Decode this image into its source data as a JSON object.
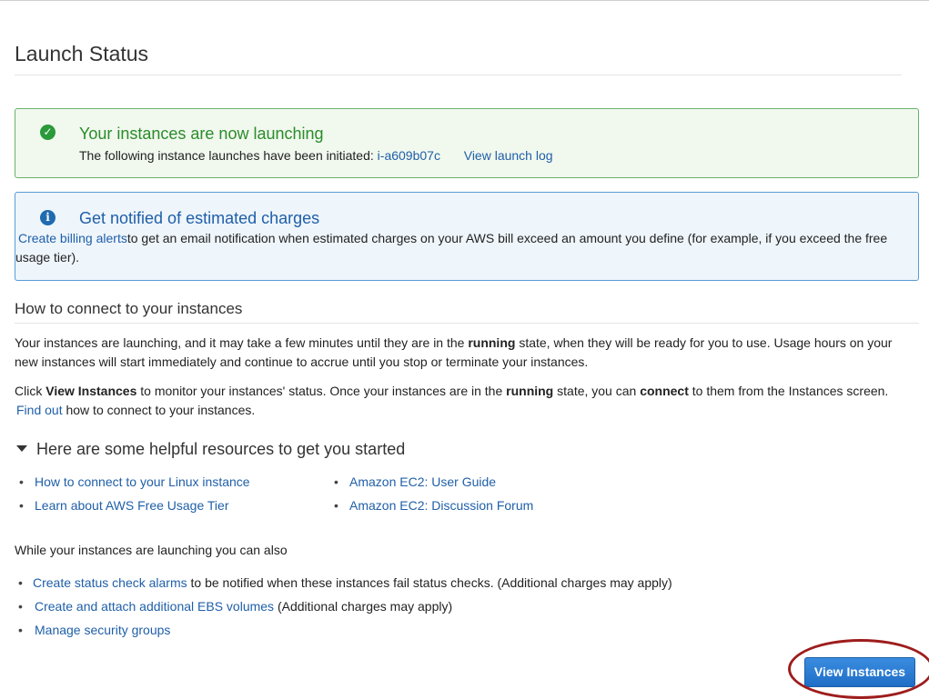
{
  "page": {
    "title": "Launch Status"
  },
  "success_alert": {
    "title": "Your instances are now launching",
    "body_text": "The following instance launches have been initiated:",
    "instance_id": "i-a609b07c",
    "log_link": "View launch log"
  },
  "info_alert": {
    "title": "Get notified of estimated charges",
    "link": "Create billing alerts",
    "body_text": "to get an email notification when estimated charges on your AWS bill exceed an amount you define (for example, if you exceed the free usage tier)."
  },
  "connect": {
    "heading": "How to connect to your instances",
    "p1_a": "Your instances are launching, and it may take a few minutes until they are in the ",
    "p1_bold": "running",
    "p1_b": " state, when they will be ready for you to use. Usage hours on your new instances will start immediately and continue to accrue until you stop or terminate your instances.",
    "p2_a": "Click ",
    "p2_bold1": "View Instances",
    "p2_b": " to monitor your instances' status. Once your instances are in the ",
    "p2_bold2": "running",
    "p2_c": " state, you can ",
    "p2_bold3": "connect",
    "p2_d": " to them from the Instances screen.",
    "find_out_link": "Find out",
    "p2_e": "how to connect to your instances."
  },
  "resources": {
    "heading": "Here are some helpful resources to get you started",
    "left": [
      "How to connect to your Linux instance",
      "Learn about AWS Free Usage Tier"
    ],
    "right": [
      "Amazon EC2: User Guide",
      "Amazon EC2: Discussion Forum"
    ]
  },
  "also": {
    "intro": "While your instances are launching you can also",
    "items": [
      {
        "link": "Create status check alarms",
        "text": "to be notified when these instances fail status checks. (Additional charges may apply)"
      },
      {
        "link": "Create and attach additional EBS volumes",
        "text": "(Additional charges may apply)"
      },
      {
        "link": "Manage security groups",
        "text": ""
      }
    ]
  },
  "button": {
    "label": "View Instances"
  },
  "colors": {
    "success": "#2a8c2a",
    "info": "#1f5fa8",
    "link": "#1f5fa8",
    "button": "#1f6ec6",
    "highlight_ring": "#9e1d1d"
  },
  "icons": {
    "success": "check-circle-icon",
    "info": "info-circle-icon",
    "caret": "caret-down-icon"
  }
}
